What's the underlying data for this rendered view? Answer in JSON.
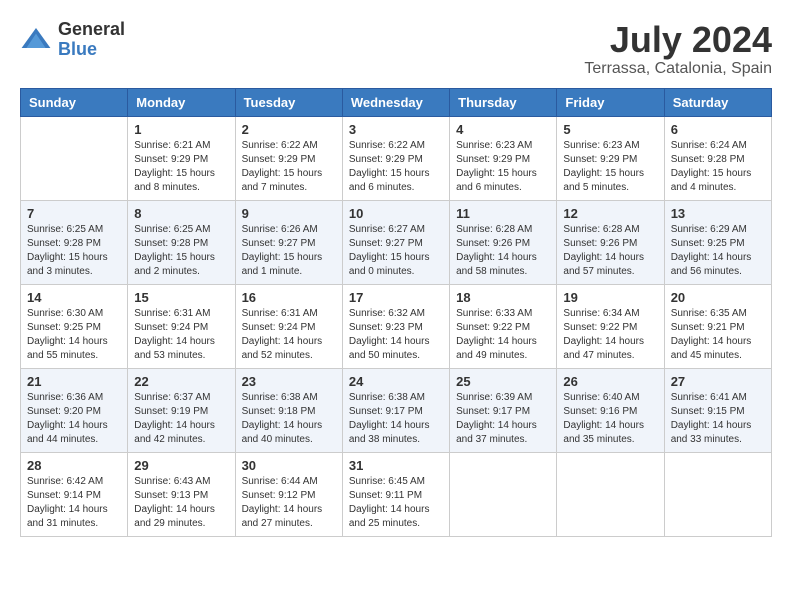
{
  "header": {
    "logo_general": "General",
    "logo_blue": "Blue",
    "month_title": "July 2024",
    "location": "Terrassa, Catalonia, Spain"
  },
  "calendar": {
    "days_of_week": [
      "Sunday",
      "Monday",
      "Tuesday",
      "Wednesday",
      "Thursday",
      "Friday",
      "Saturday"
    ],
    "weeks": [
      [
        {
          "day": "",
          "sunrise": "",
          "sunset": "",
          "daylight": ""
        },
        {
          "day": "1",
          "sunrise": "Sunrise: 6:21 AM",
          "sunset": "Sunset: 9:29 PM",
          "daylight": "Daylight: 15 hours and 8 minutes."
        },
        {
          "day": "2",
          "sunrise": "Sunrise: 6:22 AM",
          "sunset": "Sunset: 9:29 PM",
          "daylight": "Daylight: 15 hours and 7 minutes."
        },
        {
          "day": "3",
          "sunrise": "Sunrise: 6:22 AM",
          "sunset": "Sunset: 9:29 PM",
          "daylight": "Daylight: 15 hours and 6 minutes."
        },
        {
          "day": "4",
          "sunrise": "Sunrise: 6:23 AM",
          "sunset": "Sunset: 9:29 PM",
          "daylight": "Daylight: 15 hours and 6 minutes."
        },
        {
          "day": "5",
          "sunrise": "Sunrise: 6:23 AM",
          "sunset": "Sunset: 9:29 PM",
          "daylight": "Daylight: 15 hours and 5 minutes."
        },
        {
          "day": "6",
          "sunrise": "Sunrise: 6:24 AM",
          "sunset": "Sunset: 9:28 PM",
          "daylight": "Daylight: 15 hours and 4 minutes."
        }
      ],
      [
        {
          "day": "7",
          "sunrise": "Sunrise: 6:25 AM",
          "sunset": "Sunset: 9:28 PM",
          "daylight": "Daylight: 15 hours and 3 minutes."
        },
        {
          "day": "8",
          "sunrise": "Sunrise: 6:25 AM",
          "sunset": "Sunset: 9:28 PM",
          "daylight": "Daylight: 15 hours and 2 minutes."
        },
        {
          "day": "9",
          "sunrise": "Sunrise: 6:26 AM",
          "sunset": "Sunset: 9:27 PM",
          "daylight": "Daylight: 15 hours and 1 minute."
        },
        {
          "day": "10",
          "sunrise": "Sunrise: 6:27 AM",
          "sunset": "Sunset: 9:27 PM",
          "daylight": "Daylight: 15 hours and 0 minutes."
        },
        {
          "day": "11",
          "sunrise": "Sunrise: 6:28 AM",
          "sunset": "Sunset: 9:26 PM",
          "daylight": "Daylight: 14 hours and 58 minutes."
        },
        {
          "day": "12",
          "sunrise": "Sunrise: 6:28 AM",
          "sunset": "Sunset: 9:26 PM",
          "daylight": "Daylight: 14 hours and 57 minutes."
        },
        {
          "day": "13",
          "sunrise": "Sunrise: 6:29 AM",
          "sunset": "Sunset: 9:25 PM",
          "daylight": "Daylight: 14 hours and 56 minutes."
        }
      ],
      [
        {
          "day": "14",
          "sunrise": "Sunrise: 6:30 AM",
          "sunset": "Sunset: 9:25 PM",
          "daylight": "Daylight: 14 hours and 55 minutes."
        },
        {
          "day": "15",
          "sunrise": "Sunrise: 6:31 AM",
          "sunset": "Sunset: 9:24 PM",
          "daylight": "Daylight: 14 hours and 53 minutes."
        },
        {
          "day": "16",
          "sunrise": "Sunrise: 6:31 AM",
          "sunset": "Sunset: 9:24 PM",
          "daylight": "Daylight: 14 hours and 52 minutes."
        },
        {
          "day": "17",
          "sunrise": "Sunrise: 6:32 AM",
          "sunset": "Sunset: 9:23 PM",
          "daylight": "Daylight: 14 hours and 50 minutes."
        },
        {
          "day": "18",
          "sunrise": "Sunrise: 6:33 AM",
          "sunset": "Sunset: 9:22 PM",
          "daylight": "Daylight: 14 hours and 49 minutes."
        },
        {
          "day": "19",
          "sunrise": "Sunrise: 6:34 AM",
          "sunset": "Sunset: 9:22 PM",
          "daylight": "Daylight: 14 hours and 47 minutes."
        },
        {
          "day": "20",
          "sunrise": "Sunrise: 6:35 AM",
          "sunset": "Sunset: 9:21 PM",
          "daylight": "Daylight: 14 hours and 45 minutes."
        }
      ],
      [
        {
          "day": "21",
          "sunrise": "Sunrise: 6:36 AM",
          "sunset": "Sunset: 9:20 PM",
          "daylight": "Daylight: 14 hours and 44 minutes."
        },
        {
          "day": "22",
          "sunrise": "Sunrise: 6:37 AM",
          "sunset": "Sunset: 9:19 PM",
          "daylight": "Daylight: 14 hours and 42 minutes."
        },
        {
          "day": "23",
          "sunrise": "Sunrise: 6:38 AM",
          "sunset": "Sunset: 9:18 PM",
          "daylight": "Daylight: 14 hours and 40 minutes."
        },
        {
          "day": "24",
          "sunrise": "Sunrise: 6:38 AM",
          "sunset": "Sunset: 9:17 PM",
          "daylight": "Daylight: 14 hours and 38 minutes."
        },
        {
          "day": "25",
          "sunrise": "Sunrise: 6:39 AM",
          "sunset": "Sunset: 9:17 PM",
          "daylight": "Daylight: 14 hours and 37 minutes."
        },
        {
          "day": "26",
          "sunrise": "Sunrise: 6:40 AM",
          "sunset": "Sunset: 9:16 PM",
          "daylight": "Daylight: 14 hours and 35 minutes."
        },
        {
          "day": "27",
          "sunrise": "Sunrise: 6:41 AM",
          "sunset": "Sunset: 9:15 PM",
          "daylight": "Daylight: 14 hours and 33 minutes."
        }
      ],
      [
        {
          "day": "28",
          "sunrise": "Sunrise: 6:42 AM",
          "sunset": "Sunset: 9:14 PM",
          "daylight": "Daylight: 14 hours and 31 minutes."
        },
        {
          "day": "29",
          "sunrise": "Sunrise: 6:43 AM",
          "sunset": "Sunset: 9:13 PM",
          "daylight": "Daylight: 14 hours and 29 minutes."
        },
        {
          "day": "30",
          "sunrise": "Sunrise: 6:44 AM",
          "sunset": "Sunset: 9:12 PM",
          "daylight": "Daylight: 14 hours and 27 minutes."
        },
        {
          "day": "31",
          "sunrise": "Sunrise: 6:45 AM",
          "sunset": "Sunset: 9:11 PM",
          "daylight": "Daylight: 14 hours and 25 minutes."
        },
        {
          "day": "",
          "sunrise": "",
          "sunset": "",
          "daylight": ""
        },
        {
          "day": "",
          "sunrise": "",
          "sunset": "",
          "daylight": ""
        },
        {
          "day": "",
          "sunrise": "",
          "sunset": "",
          "daylight": ""
        }
      ]
    ]
  }
}
